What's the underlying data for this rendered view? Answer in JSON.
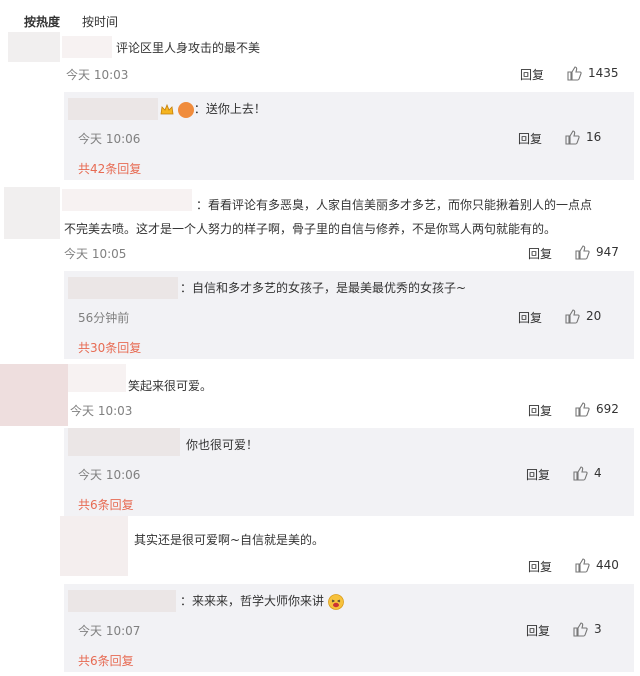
{
  "sort": {
    "hot": "按热度",
    "time": "按时间"
  },
  "comments": [
    {
      "text": "评论区里人身攻击的最不美",
      "time": "今天 10:03",
      "reply_label": "回复",
      "likes": "1435",
      "sub_reply": {
        "text": "：送你上去！",
        "time": "今天 10:06",
        "reply_label": "回复",
        "likes": "16"
      },
      "more": "共42条回复"
    },
    {
      "text_line1": "：看看评论有多恶臭，人家自信美丽多才多艺，而你只能揪着别人的一点点",
      "text_line2": "不完美去喷。这才是一个人努力的样子啊，骨子里的自信与修养，不是你骂人两句就能有的。",
      "time": "今天 10:05",
      "reply_label": "回复",
      "likes": "947",
      "sub_reply": {
        "text": "：自信和多才多艺的女孩子，是最美最优秀的女孩子~",
        "time": "56分钟前",
        "reply_label": "回复",
        "likes": "20"
      },
      "more": "共30条回复"
    },
    {
      "text": "笑起来很可爱。",
      "time": "今天 10:03",
      "reply_label": "回复",
      "likes": "692",
      "sub_reply": {
        "text": "你也很可爱！",
        "time": "今天 10:06",
        "reply_label": "回复",
        "likes": "4"
      },
      "more": "共6条回复"
    },
    {
      "text": "其实还是很可爱啊~自信就是美的。",
      "reply_label": "回复",
      "likes": "440",
      "sub_reply": {
        "text": "：来来来，哲学大师你来讲",
        "time": "今天 10:07",
        "reply_label": "回复",
        "likes": "3"
      },
      "more": "共6条回复"
    }
  ]
}
